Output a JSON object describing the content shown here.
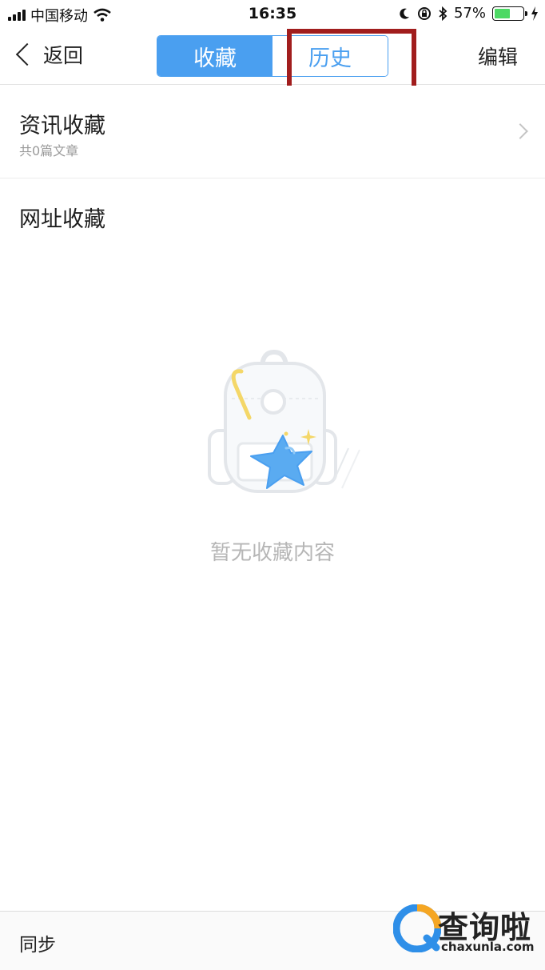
{
  "status_bar": {
    "carrier": "中国移动",
    "time": "16:35",
    "battery_percent_label": "57%",
    "battery_level": 0.57
  },
  "nav": {
    "back_label": "返回",
    "tabs": [
      {
        "label": "收藏",
        "active": true
      },
      {
        "label": "历史",
        "active": false
      }
    ],
    "edit_label": "编辑",
    "accent_color": "#4a9ff0"
  },
  "list": {
    "news_favorites": {
      "title": "资讯收藏",
      "subtitle": "共0篇文章"
    },
    "url_favorites": {
      "title": "网址收藏"
    }
  },
  "empty_state": {
    "message": "暂无收藏内容",
    "icon": "backpack-star-icon"
  },
  "bottom": {
    "sync_label": "同步"
  },
  "watermark": {
    "text_cn": "查询啦",
    "text_en": "chaxunla.com"
  },
  "annotation": {
    "highlight_color": "#a11d1d"
  }
}
